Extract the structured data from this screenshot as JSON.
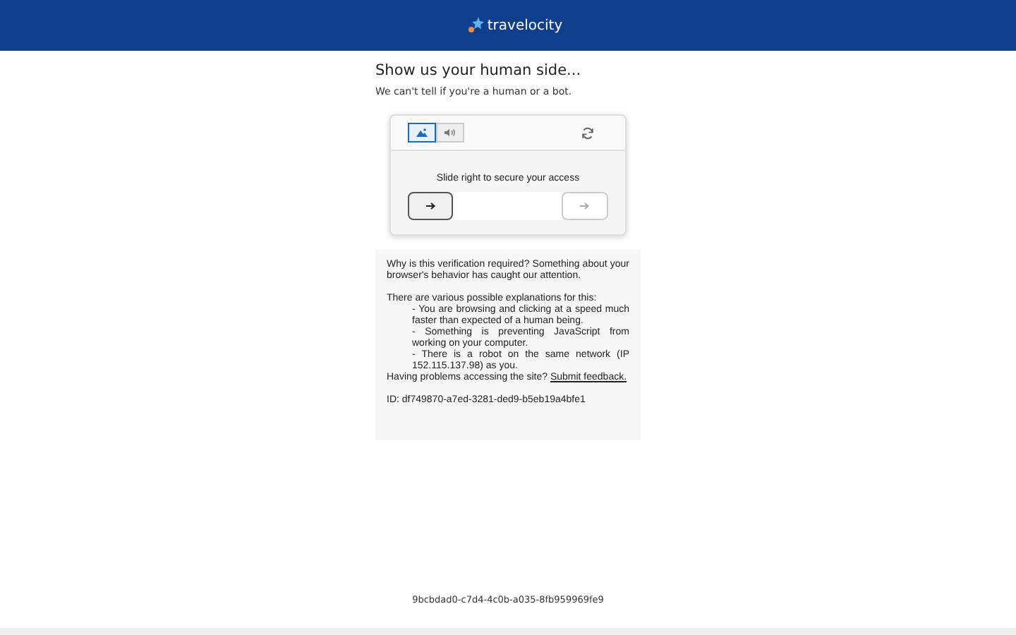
{
  "header": {
    "logo_text": "travelocity"
  },
  "title": "Show us your human side...",
  "subtitle": "We can't tell if you're a human or a bot.",
  "captcha": {
    "tabs": [
      {
        "kind": "image",
        "selected": true
      },
      {
        "kind": "audio",
        "selected": false
      }
    ],
    "instruction": "Slide right to secure your access"
  },
  "info": {
    "intro": "Why is this verification required? Something about your browser's behavior has caught our attention.",
    "explanations_heading": "There are various possible explanations for this:",
    "explanations": [
      "- You are browsing and clicking at a speed much faster than expected of a human being.",
      "- Something is preventing JavaScript from working on your computer.",
      "- There is a robot on the same network (IP 152.115.137.98) as you."
    ],
    "problems": "Having problems accessing the site?",
    "feedback_link": "Submit feedback.",
    "id": "ID: df749870-a7ed-3281-ded9-b5eb19a4bfe1"
  },
  "footer_id": "9bcbdad0-c7d4-4c0b-a035-8fb959969fe9"
}
